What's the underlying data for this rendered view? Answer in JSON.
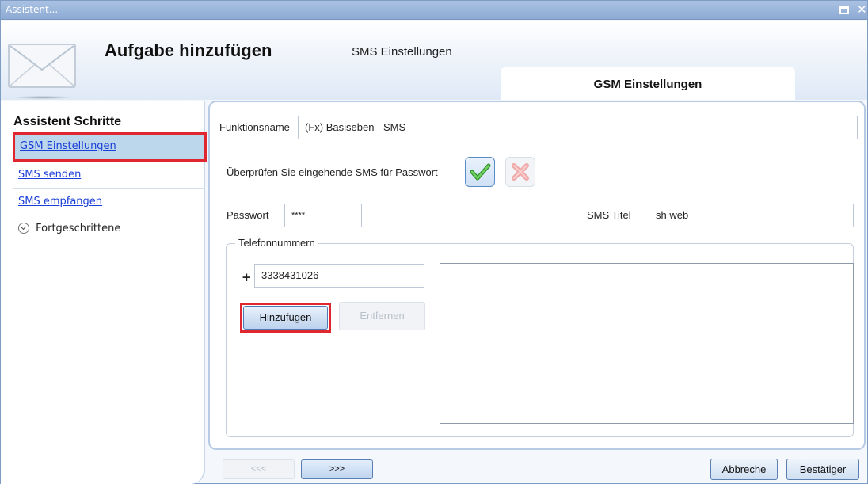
{
  "window": {
    "title": "Assistent..."
  },
  "header": {
    "title": "Aufgabe hinzufügen",
    "subtitle": "SMS Einstellungen",
    "active_tab": "GSM Einstellungen"
  },
  "sidebar": {
    "heading": "Assistent Schritte",
    "items": [
      {
        "label": "GSM Einstellungen",
        "selected": true
      },
      {
        "label": "SMS senden"
      },
      {
        "label": "SMS empfangen"
      }
    ],
    "advanced_label": "Fortgeschrittene"
  },
  "form": {
    "function_name_label": "Funktionsname",
    "function_name_value": "(Fx) Basiseben - SMS",
    "check_sms_label": "Überprüfen Sie eingehende SMS für Passwort",
    "password_label": "Passwort",
    "password_value": "****",
    "sms_title_label": "SMS Titel",
    "sms_title_value": "sh web",
    "phone_group_label": "Telefonnummern",
    "phone_prefix": "+",
    "phone_value": "3338431026",
    "add_label": "Hinzufügen",
    "remove_label": "Entfernen",
    "phone_list": []
  },
  "footer": {
    "prev_label": "<<<",
    "next_label": ">>>",
    "cancel_label": "Abbreche",
    "confirm_label": "Bestätiger"
  },
  "colors": {
    "accent_blue": "#1a3ed8",
    "highlight_red": "#e0262f",
    "selected_bg": "#bcd6ec"
  }
}
